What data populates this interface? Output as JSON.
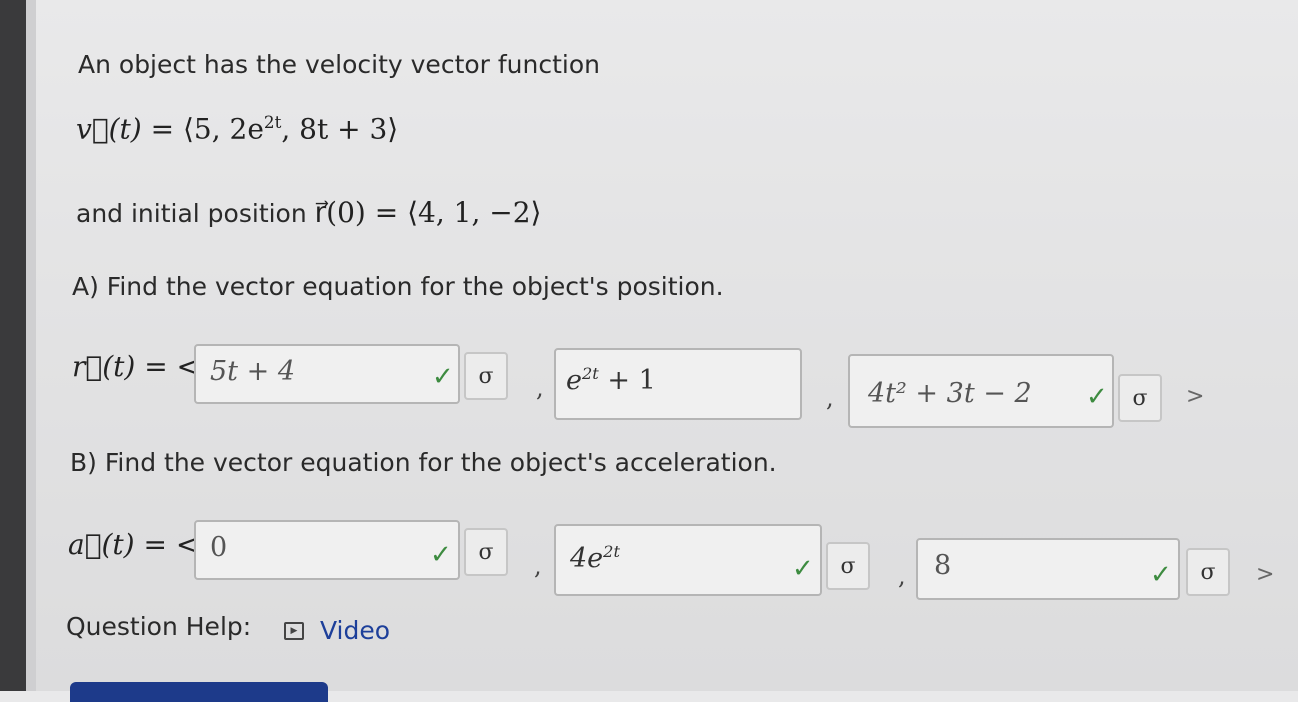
{
  "intro": {
    "line1": "An object has the velocity vector function",
    "velocity_lhs": "v⃗(t) = ",
    "velocity_open": "⟨5, 2e",
    "velocity_exp": "2t",
    "velocity_close": ", 8t + 3⟩",
    "line3_text": "and initial position ",
    "position_expr": "r⃗(0) = ⟨4, 1, −2⟩"
  },
  "partA": {
    "prompt": "A) Find the vector equation for the object's position.",
    "lhs": "r⃗(t) = <",
    "answers": [
      {
        "value": "5t + 4",
        "correct": true
      },
      {
        "base": "e",
        "exp": "2t",
        "rest": " + 1",
        "correct": false
      },
      {
        "value": "4t² + 3t − 2",
        "correct": true
      }
    ],
    "check_glyph": "✓",
    "key_glyph": "σ",
    "separator": ",",
    "close": ">"
  },
  "partB": {
    "prompt": "B) Find the vector equation for the object's acceleration.",
    "lhs": "a⃗(t) = <",
    "answers": [
      {
        "value": "0",
        "correct": true
      },
      {
        "base": "4e",
        "exp": "2t",
        "correct": true
      },
      {
        "value": "8",
        "correct": true
      }
    ],
    "check_glyph": "✓",
    "key_glyph": "σ",
    "separator": ",",
    "close": ">"
  },
  "help": {
    "label": "Question Help:",
    "video_label": "Video"
  }
}
